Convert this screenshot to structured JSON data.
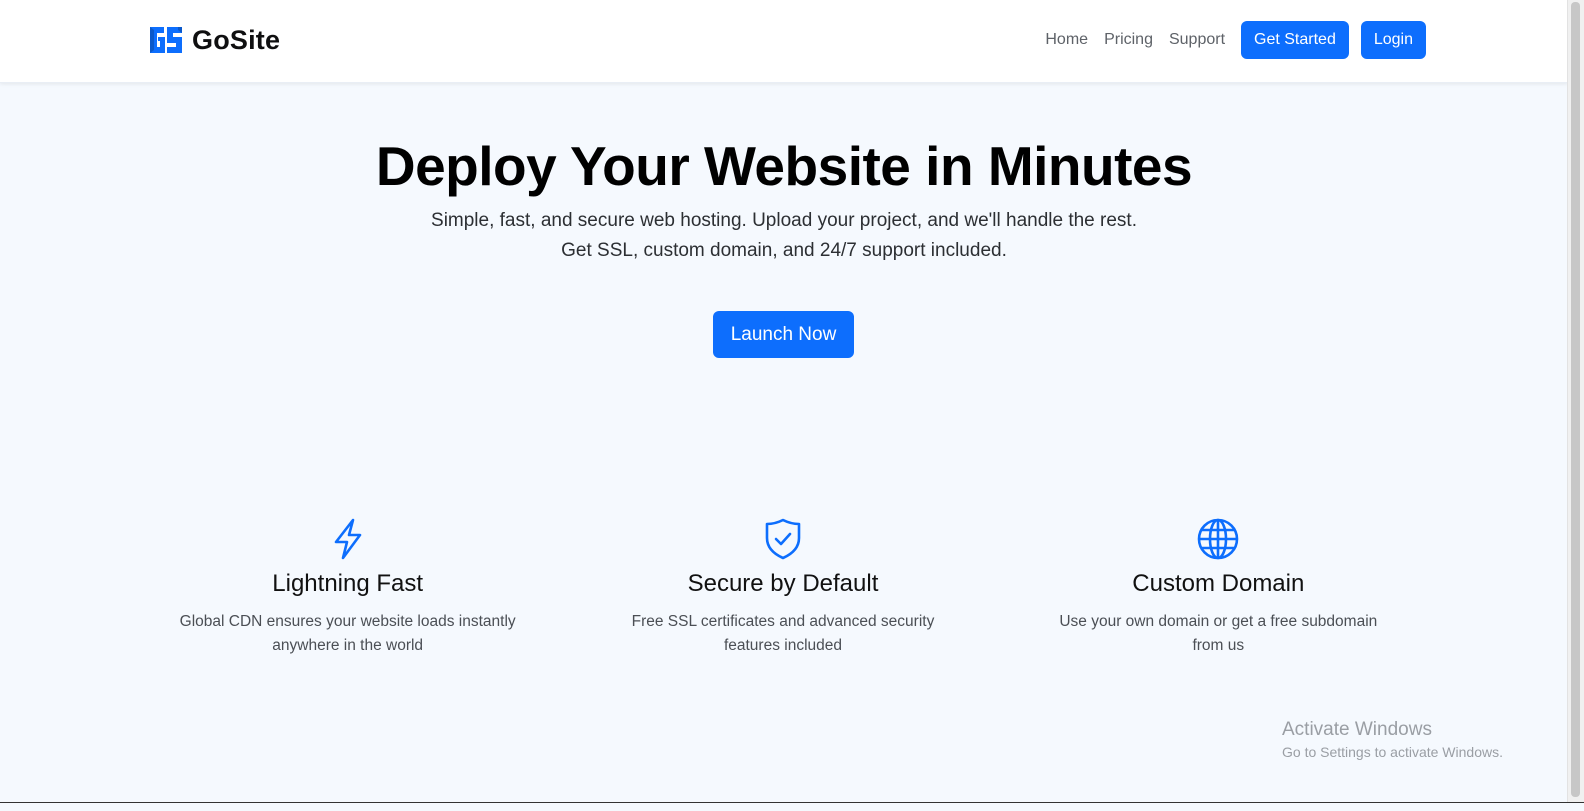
{
  "brand": {
    "name": "GoSite",
    "logo_icon": "gs-logo-icon",
    "accent": "#0d6efd"
  },
  "nav": {
    "links": [
      {
        "label": "Home"
      },
      {
        "label": "Pricing"
      },
      {
        "label": "Support"
      }
    ],
    "get_started_label": "Get Started",
    "login_label": "Login"
  },
  "hero": {
    "title": "Deploy Your Website in Minutes",
    "subtitle_line1": "Simple, fast, and secure web hosting. Upload your project, and we'll handle the rest.",
    "subtitle_line2": "Get SSL, custom domain, and 24/7 support included.",
    "cta_label": "Launch Now"
  },
  "features": [
    {
      "icon": "lightning-icon",
      "title": "Lightning Fast",
      "description": "Global CDN ensures your website loads instantly anywhere in the world"
    },
    {
      "icon": "shield-check-icon",
      "title": "Secure by Default",
      "description": "Free SSL certificates and advanced security features included"
    },
    {
      "icon": "globe-icon",
      "title": "Custom Domain",
      "description": "Use your own domain or get a free subdomain from us"
    }
  ],
  "watermark": {
    "title": "Activate Windows",
    "subtitle": "Go to Settings to activate Windows."
  },
  "colors": {
    "primary": "#0d6efd",
    "background": "#f5f9fe",
    "header_bg": "#ffffff"
  }
}
